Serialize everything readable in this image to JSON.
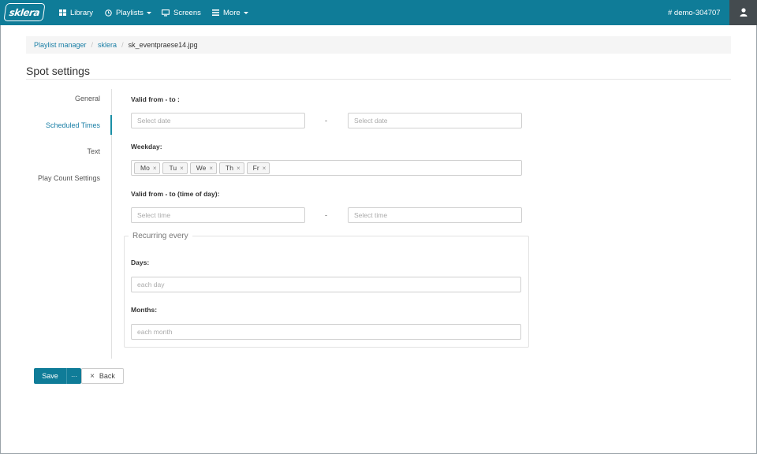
{
  "navbar": {
    "logo_text": "sklera",
    "items": [
      {
        "label": "Library",
        "icon": "grid-icon"
      },
      {
        "label": "Playlists",
        "icon": "clock-icon"
      },
      {
        "label": "Screens",
        "icon": "monitor-icon"
      },
      {
        "label": "More",
        "icon": "list-icon"
      }
    ],
    "account": "# demo-304707",
    "user_icon": "user-icon",
    "bg_color": "#0f7c98"
  },
  "breadcrumb": {
    "items": [
      "Playlist manager",
      "sklera"
    ],
    "current": "sk_eventpraese14.jpg",
    "separator": "/"
  },
  "page": {
    "title": "Spot settings"
  },
  "tabs": [
    {
      "label": "General",
      "active": false
    },
    {
      "label": "Scheduled Times",
      "active": true
    },
    {
      "label": "Text",
      "active": false
    },
    {
      "label": "Play Count Settings",
      "active": false
    }
  ],
  "form": {
    "valid_dates": {
      "label": "Valid from - to",
      "from_placeholder": "Select date",
      "to_placeholder": "Select date",
      "separator": "-"
    },
    "weekday": {
      "label": "Weekday",
      "tags": [
        "Mo",
        "Tu",
        "We",
        "Th",
        "Fr"
      ],
      "remove_glyph": "×"
    },
    "valid_times": {
      "label": "Valid from - to (time of day)",
      "from_placeholder": "Select time",
      "to_placeholder": "Select time",
      "separator": "-"
    },
    "recurring": {
      "legend": "Recurring every",
      "days_label": "Days",
      "days_placeholder": "each day",
      "months_label": "Months",
      "months_placeholder": "each month"
    },
    "label_suffix": ":"
  },
  "actions": {
    "save_label": "Save",
    "more_label": "···",
    "back_label": "Back",
    "back_glyph": "×"
  }
}
